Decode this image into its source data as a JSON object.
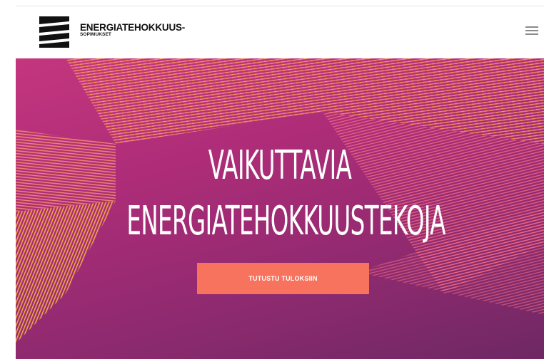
{
  "header": {
    "logo": {
      "line1": "ENERGIATEHOKKUUS-",
      "line2": "SOPIMUKSET",
      "icon": "stacked-bars-logo-icon"
    },
    "menu_icon": "hamburger-menu-icon"
  },
  "hero": {
    "title_line1": "VAIKUTTAVIA",
    "title_line2": "ENERGIATEHOKKUUSTEKOJA",
    "cta_label": "TUTUSTU TULOKSIIN"
  },
  "colors": {
    "hero_background": "#b3307a",
    "cta_background": "#f7735d",
    "stripes_warm": "#f5b04a",
    "stripes_pink": "#f36a7e"
  }
}
